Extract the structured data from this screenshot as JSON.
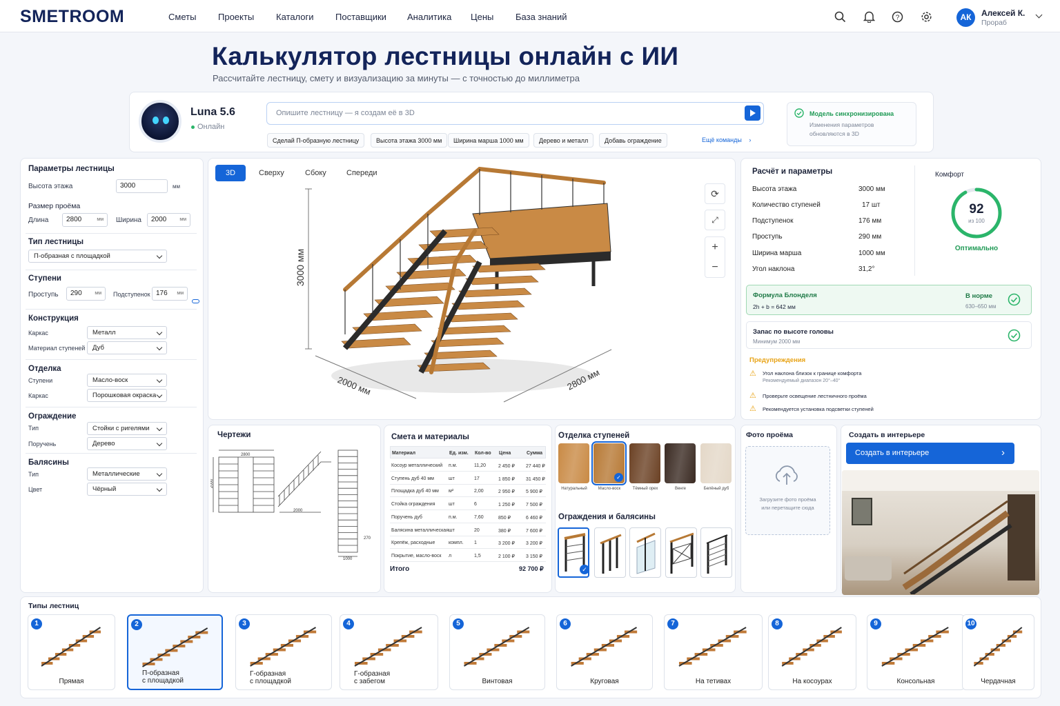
{
  "brand": "SMETROOM",
  "nav": [
    "Сметы",
    "Проекты",
    "Каталоги",
    "Поставщики",
    "Аналитика",
    "Цены",
    "База знаний"
  ],
  "user": {
    "initials": "АК",
    "name": "Алексей К.",
    "role": "Прораб"
  },
  "hero": {
    "title": "Калькулятор лестницы онлайн с ИИ",
    "subtitle": "Рассчитайте лестницу, смету и визуализацию за минуты — с точностью до миллиметра"
  },
  "assistant": {
    "name": "Luna 5.6",
    "status": "Онлайн",
    "placeholder": "Опишите лестницу — я создам её в 3D",
    "chips": [
      "Сделай П-образную лестницу",
      "Высота этажа 3000 мм",
      "Ширина марша 1000 мм",
      "Дерево и металл",
      "Добавь ограждение"
    ],
    "more": "Ещё команды",
    "sync_title": "Модель синхронизирована",
    "sync_text1": "Изменения параметров",
    "sync_text2": "обновляются в 3D"
  },
  "params": {
    "title": "Параметры лестницы",
    "floor_label": "Высота этажа",
    "floor_value": "3000",
    "unit": "мм",
    "opening_title": "Размер проёма",
    "len_label": "Длина",
    "len_value": "2800",
    "wid_label": "Ширина",
    "wid_value": "2000",
    "type_title": "Тип лестницы",
    "type_value": "П-образная с площадкой",
    "steps_title": "Ступени",
    "tread_label": "Проступь",
    "tread_value": "290",
    "riser_label": "Подступенок",
    "riser_value": "176",
    "constr_title": "Конструкция",
    "frame_label": "Каркас",
    "frame_value": "Металл",
    "stepmat_label": "Материал ступеней",
    "stepmat_value": "Дуб",
    "finish_title": "Отделка",
    "fsteps_label": "Ступени",
    "fsteps_value": "Масло-воск",
    "fframe_label": "Каркас",
    "fframe_value": "Порошковая окраска",
    "fence_title": "Ограждение",
    "fence_type_label": "Тип",
    "fence_type_value": "Стойки с ригелями",
    "rail_label": "Поручень",
    "rail_value": "Дерево",
    "bal_title": "Балясины",
    "bal_type_label": "Тип",
    "bal_type_value": "Металлические",
    "color_label": "Цвет",
    "color_value": "Чёрный",
    "small_unit": "мм"
  },
  "viewer": {
    "tabs": [
      "3D",
      "Сверху",
      "Сбоку",
      "Спереди"
    ],
    "dim_h": "3000 мм",
    "dim_w": "2000 мм",
    "dim_l": "2800 мм"
  },
  "calc": {
    "title": "Расчёт и параметры",
    "rows": [
      {
        "k": "Высота этажа",
        "v": "3000 мм"
      },
      {
        "k": "Количество ступеней",
        "v": "17 шт"
      },
      {
        "k": "Подступенок",
        "v": "176 мм"
      },
      {
        "k": "Проступь",
        "v": "290 мм"
      },
      {
        "k": "Ширина марша",
        "v": "1000 мм"
      },
      {
        "k": "Угол наклона",
        "v": "31,2°"
      }
    ],
    "comfort_label": "Комфорт",
    "comfort_value": "92",
    "comfort_of": "из 100",
    "comfort_state": "Оптимально",
    "comfort_fraction": 0.92,
    "blondel_title": "Формула Блонделя",
    "blondel_formula": "2h + b = 642 мм",
    "blondel_ok": "В норме",
    "blondel_range": "630–650 мм",
    "head_title": "Запас по высоте головы",
    "head_text": "Минимум 2000 мм",
    "warn_title": "Предупреждения",
    "warn1": "Угол наклона близок к границе комфорта",
    "warn1_sub": "Рекомендуемый диапазон 20°–40°",
    "warn2": "Проверьте освещение лестничного проёма",
    "warn3": "Рекомендуется установка подсветки ступеней"
  },
  "drawings": {
    "title": "Чертежи",
    "d1": "2800",
    "d2": "2000",
    "d3": "2000",
    "d4": "270",
    "d5": "1000"
  },
  "estimate": {
    "title": "Смета и материалы",
    "head": [
      "Материал",
      "Ед. изм.",
      "Кол-во",
      "Цена",
      "Сумма"
    ],
    "rows": [
      [
        "Косоур металлический",
        "п.м.",
        "11,20",
        "2 450 ₽",
        "27 440 ₽"
      ],
      [
        "Ступень дуб 40 мм",
        "шт",
        "17",
        "1 850 ₽",
        "31 450 ₽"
      ],
      [
        "Площадка дуб 40 мм",
        "м²",
        "2,00",
        "2 950 ₽",
        "5 900 ₽"
      ],
      [
        "Стойка ограждения",
        "шт",
        "6",
        "1 250 ₽",
        "7 500 ₽"
      ],
      [
        "Поручень дуб",
        "п.м.",
        "7,60",
        "850 ₽",
        "6 460 ₽"
      ],
      [
        "Балясина металлическая",
        "шт",
        "20",
        "380 ₽",
        "7 600 ₽"
      ],
      [
        "Крепёж, расходные",
        "компл.",
        "1",
        "3 200 ₽",
        "3 200 ₽"
      ],
      [
        "Покрытие, масло-воск",
        "л",
        "1,5",
        "2 100 ₽",
        "3 150 ₽"
      ]
    ],
    "total_label": "Итого",
    "total_value": "92 700 ₽"
  },
  "finish": {
    "title": "Отделка ступеней",
    "swatches": [
      {
        "name": "Натуральный",
        "color": "#c98a45"
      },
      {
        "name": "Масло-воск",
        "color": "#b77935"
      },
      {
        "name": "Тёмный орех",
        "color": "#6b4124"
      },
      {
        "name": "Венге",
        "color": "#3a2a22"
      },
      {
        "name": "Белёный дуб",
        "color": "#e4d8c8"
      }
    ],
    "rails_title": "Ограждения и балясины"
  },
  "photo": {
    "title": "Фото проёма",
    "upload1": "Загрузите фото проёма",
    "upload2": "или перетащите сюда"
  },
  "interior": {
    "title": "Создать в интерьере",
    "button": "Создать в интерьере"
  },
  "types": {
    "title": "Типы лестниц",
    "items": [
      {
        "n": "1",
        "name": "Прямая"
      },
      {
        "n": "2",
        "name": "П-образная\nс площадкой"
      },
      {
        "n": "3",
        "name": "Г-образная\nс площадкой"
      },
      {
        "n": "4",
        "name": "Г-образная\nс забегом"
      },
      {
        "n": "5",
        "name": "Винтовая"
      },
      {
        "n": "6",
        "name": "Круговая"
      },
      {
        "n": "7",
        "name": "На тетивах"
      },
      {
        "n": "8",
        "name": "На косоурах"
      },
      {
        "n": "9",
        "name": "Консольная"
      },
      {
        "n": "10",
        "name": "Чердачная"
      }
    ]
  },
  "colors": {
    "accent": "#1565d8",
    "ok": "#2bb56a",
    "warn": "#e8a316",
    "navy": "#13245a"
  }
}
